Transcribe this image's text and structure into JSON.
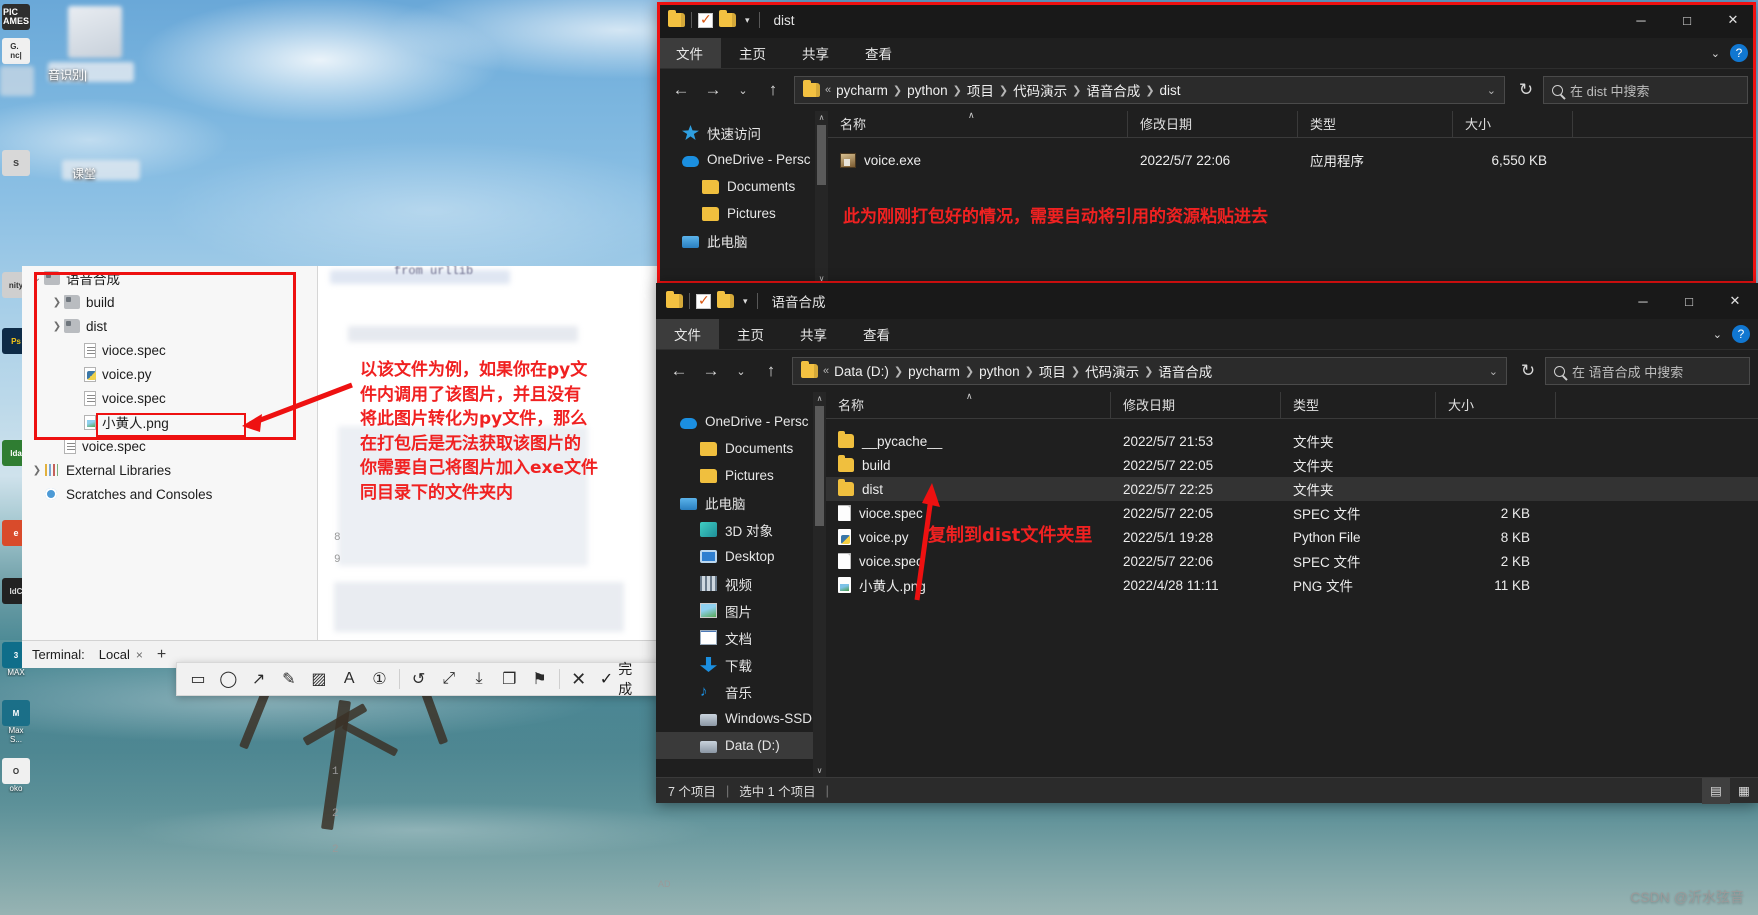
{
  "desktop": {
    "icons": [
      {
        "label": "PIC GAMES"
      },
      {
        "label": "G... nc|"
      },
      {
        "label": "音识别|"
      },
      {
        "label": "s"
      },
      {
        "label": "课堂"
      },
      {
        "label": "nity"
      },
      {
        "label": "ips"
      },
      {
        "label": "lda"
      },
      {
        "label": "e"
      },
      {
        "label": "IdC"
      },
      {
        "label": "3 MAX"
      },
      {
        "label": "Max S..."
      },
      {
        "label": "oko"
      }
    ]
  },
  "window_top": {
    "title": "dist",
    "tabs": [
      "文件",
      "主页",
      "共享",
      "查看"
    ],
    "breadcrumb": [
      "pycharm",
      "python",
      "项目",
      "代码演示",
      "语音合成",
      "dist"
    ],
    "search_placeholder": "在 dist 中搜索",
    "sidebar": [
      {
        "label": "快速访问",
        "icon": "star-pin-icon",
        "indent": false
      },
      {
        "label": "OneDrive - Persc",
        "icon": "onedrive-cloud-icon",
        "indent": false
      },
      {
        "label": "Documents",
        "icon": "folder-icon",
        "indent": true
      },
      {
        "label": "Pictures",
        "icon": "folder-icon",
        "indent": true
      },
      {
        "label": "此电脑",
        "icon": "this-pc-icon",
        "indent": false
      }
    ],
    "columns": [
      "名称",
      "修改日期",
      "类型",
      "大小"
    ],
    "rows": [
      {
        "name": "voice.exe",
        "icon": "exe",
        "date": "2022/5/7 22:06",
        "type": "应用程序",
        "size": "6,550 KB",
        "selected": false
      }
    ],
    "annotation": "此为刚刚打包好的情况，需要自动将引用的资源粘贴进去"
  },
  "window_bottom": {
    "title": "语音合成",
    "tabs": [
      "文件",
      "主页",
      "共享",
      "查看"
    ],
    "breadcrumb": [
      "Data (D:)",
      "pycharm",
      "python",
      "项目",
      "代码演示",
      "语音合成"
    ],
    "search_placeholder": "在 语音合成 中搜索",
    "sidebar": [
      {
        "label": "OneDrive - Persc",
        "icon": "onedrive-cloud-icon",
        "indent": false
      },
      {
        "label": "Documents",
        "icon": "folder-icon",
        "indent": true
      },
      {
        "label": "Pictures",
        "icon": "folder-icon",
        "indent": true
      },
      {
        "label": "此电脑",
        "icon": "this-pc-icon",
        "indent": false
      },
      {
        "label": "3D 对象",
        "icon": "3d-objects-icon",
        "indent": true
      },
      {
        "label": "Desktop",
        "icon": "desktop-icon",
        "indent": true
      },
      {
        "label": "视频",
        "icon": "videos-icon",
        "indent": true
      },
      {
        "label": "图片",
        "icon": "pictures-icon",
        "indent": true
      },
      {
        "label": "文档",
        "icon": "documents-icon",
        "indent": true
      },
      {
        "label": "下载",
        "icon": "downloads-icon",
        "indent": true
      },
      {
        "label": "音乐",
        "icon": "music-icon",
        "indent": true
      },
      {
        "label": "Windows-SSD (",
        "icon": "drive-icon",
        "indent": true
      },
      {
        "label": "Data (D:)",
        "icon": "drive-icon",
        "indent": true,
        "selected": true
      }
    ],
    "columns": [
      "名称",
      "修改日期",
      "类型",
      "大小"
    ],
    "rows": [
      {
        "name": "__pycache__",
        "icon": "folder",
        "date": "2022/5/7 21:53",
        "type": "文件夹",
        "size": "",
        "selected": false
      },
      {
        "name": "build",
        "icon": "folder",
        "date": "2022/5/7 22:05",
        "type": "文件夹",
        "size": "",
        "selected": false
      },
      {
        "name": "dist",
        "icon": "folder",
        "date": "2022/5/7 22:25",
        "type": "文件夹",
        "size": "",
        "selected": true
      },
      {
        "name": "vioce.spec",
        "icon": "doc",
        "date": "2022/5/7 22:05",
        "type": "SPEC 文件",
        "size": "2 KB",
        "selected": false
      },
      {
        "name": "voice.py",
        "icon": "py",
        "date": "2022/5/1 19:28",
        "type": "Python File",
        "size": "8 KB",
        "selected": false
      },
      {
        "name": "voice.spec",
        "icon": "doc",
        "date": "2022/5/7 22:06",
        "type": "SPEC 文件",
        "size": "2 KB",
        "selected": false
      },
      {
        "name": "小黄人.png",
        "icon": "png",
        "date": "2022/4/28 11:11",
        "type": "PNG 文件",
        "size": "11 KB",
        "selected": false
      }
    ],
    "annotation": "复制到dist文件夹里",
    "status_count": "7 个项目",
    "status_selected": "选中 1 个项目"
  },
  "pycharm": {
    "tree": [
      {
        "label": "语音合成",
        "icon": "folder-icon",
        "arrow": "v",
        "depth": 0
      },
      {
        "label": "build",
        "icon": "folder-icon",
        "arrow": ">",
        "depth": 1
      },
      {
        "label": "dist",
        "icon": "folder-icon",
        "arrow": ">",
        "depth": 1
      },
      {
        "label": "vioce.spec",
        "icon": "spec-file-icon",
        "arrow": "",
        "depth": 2
      },
      {
        "label": "voice.py",
        "icon": "python-file-icon",
        "arrow": "",
        "depth": 2
      },
      {
        "label": "voice.spec",
        "icon": "spec-file-icon",
        "arrow": "",
        "depth": 2
      },
      {
        "label": "小黄人.png",
        "icon": "png-file-icon",
        "arrow": "",
        "depth": 2,
        "boxed": true
      },
      {
        "label": "voice.spec",
        "icon": "spec-file-icon",
        "arrow": "",
        "depth": 1
      },
      {
        "label": "External Libraries",
        "icon": "libraries-icon",
        "arrow": ">",
        "depth": 0
      },
      {
        "label": "Scratches and Consoles",
        "icon": "scratches-icon",
        "arrow": "",
        "depth": 0
      }
    ],
    "gutter_lines": [
      "8",
      "9",
      "1",
      "2",
      "2"
    ],
    "code_hint": "from urllib",
    "terminal_label": "Terminal:",
    "terminal_tab": "Local",
    "terminal_close": "×",
    "terminal_add": "+",
    "annotation_lines": [
      "以该文件为例，如果你在py文",
      "件内调用了该图片，并且没有",
      "将此图片转化为py文件，那么",
      "在打包后是无法获取该图片的",
      "你需要自己将图片加入exe文件",
      "同目录下的文件夹内"
    ]
  },
  "snipping_toolbar": {
    "tools": [
      "rect-icon",
      "ellipse-icon",
      "arrow-icon",
      "pen-icon",
      "highlight-icon",
      "text-icon",
      "number-icon",
      "undo-icon",
      "resize-icon",
      "download-icon",
      "copy-icon",
      "pin-icon",
      "close-icon"
    ],
    "done_label": "完成",
    "done_icon": "check-icon"
  },
  "watermark": "CSDN @沂水弦音",
  "colors": {
    "annotation_red": "#f02121",
    "frame_red": "#ee1111",
    "window_bg": "#1f1f1f",
    "titlebar_bg": "#191919",
    "selection": "#333333"
  }
}
